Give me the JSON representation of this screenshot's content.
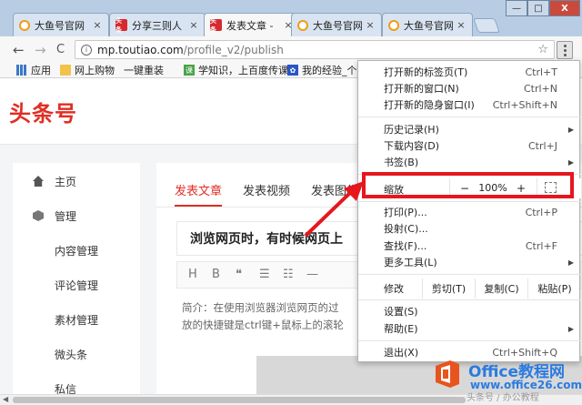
{
  "browser": {
    "tabs": [
      {
        "title": "大鱼号官网",
        "icon": "dayu-fish-icon"
      },
      {
        "title": "分享三则人",
        "icon": "toutiao-icon"
      },
      {
        "title": "发表文章 - ",
        "icon": "toutiao-icon",
        "active": true
      },
      {
        "title": "大鱼号官网",
        "icon": "dayu-fish-icon"
      },
      {
        "title": "大鱼号官网",
        "icon": "dayu-fish-icon"
      }
    ],
    "favicon_toutiao_text": "头条",
    "close_glyph": "×",
    "url_host": "mp.toutiao.com",
    "url_path": "/profile_v2/publish",
    "back_glyph": "←",
    "forward_glyph": "→",
    "reload_glyph": "C",
    "info_glyph": "i",
    "star_glyph": "☆",
    "win_min": "—",
    "win_max": "□",
    "win_close": "X"
  },
  "bookmarks": [
    {
      "label": "应用",
      "icon": "apps-icon"
    },
    {
      "label": "网上购物",
      "icon": "folder-icon"
    },
    {
      "label": "一键重装",
      "icon": "page-icon"
    },
    {
      "label": "学知识，上百度传课",
      "icon": "green-logo-icon",
      "glyph": "课"
    },
    {
      "label": "我的经验_个人",
      "icon": "baidu-paw-icon",
      "glyph": "✿"
    }
  ],
  "page": {
    "logo": "头条号",
    "sidebar": [
      {
        "label": "主页",
        "icon": "home-icon"
      },
      {
        "label": "管理",
        "icon": "cube-icon"
      },
      {
        "label": "内容管理"
      },
      {
        "label": "评论管理"
      },
      {
        "label": "素材管理"
      },
      {
        "label": "微头条"
      },
      {
        "label": "私信"
      }
    ],
    "content_tabs": [
      "发表文章",
      "发表视频",
      "发表图集"
    ],
    "title_text": "浏览网页时，有时候网页上",
    "editor_tools": [
      "H",
      "B",
      "❝",
      "☰",
      "☷",
      "—"
    ],
    "body_line1": "简介：在使用浏览器浏览网页的过",
    "body_line2": "放的快捷键是ctrl键+鼠标上的滚轮"
  },
  "menu": {
    "items_top": [
      {
        "label": "打开新的标签页(T)",
        "shortcut": "Ctrl+T"
      },
      {
        "label": "打开新的窗口(N)",
        "shortcut": "Ctrl+N"
      },
      {
        "label": "打开新的隐身窗口(I)",
        "shortcut": "Ctrl+Shift+N"
      }
    ],
    "items_history": [
      {
        "label": "历史记录(H)",
        "submenu": true
      },
      {
        "label": "下载内容(D)",
        "shortcut": "Ctrl+J"
      },
      {
        "label": "书签(B)",
        "submenu": true
      }
    ],
    "zoom": {
      "label": "缩放",
      "minus": "−",
      "value": "100%",
      "plus": "+"
    },
    "items_tools": [
      {
        "label": "打印(P)...",
        "shortcut": "Ctrl+P"
      },
      {
        "label": "投射(C)..."
      },
      {
        "label": "查找(F)...",
        "shortcut": "Ctrl+F"
      },
      {
        "label": "更多工具(L)",
        "submenu": true
      }
    ],
    "edit": {
      "label": "修改",
      "cut": "剪切(T)",
      "copy": "复制(C)",
      "paste": "粘贴(P)"
    },
    "items_settings": [
      {
        "label": "设置(S)"
      },
      {
        "label": "帮助(E)",
        "submenu": true
      }
    ],
    "exit": {
      "label": "退出(X)",
      "shortcut": "Ctrl+Shift+Q"
    },
    "submenu_glyph": "▶"
  },
  "watermark": {
    "line1": "Office教程网",
    "line2": "www.office26.com",
    "line3": "头条号 / 办公教程"
  },
  "colors": {
    "accent": "#e02e24",
    "highlight": "#e5171d",
    "watermark": "#2c7be0"
  }
}
